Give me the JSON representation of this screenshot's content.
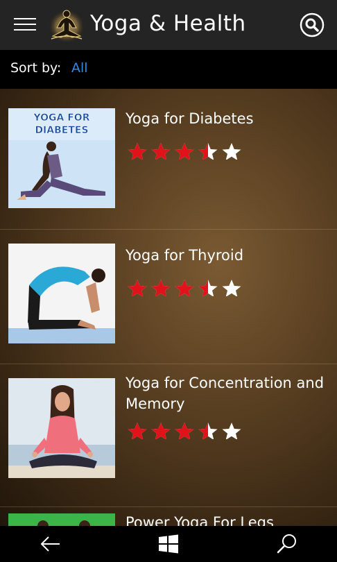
{
  "header": {
    "title": "Yoga & Health",
    "menu_icon": "hamburger-icon",
    "logo_icon": "yoga-lotus-logo-icon",
    "search_icon": "search-icon"
  },
  "sort": {
    "label": "Sort by:",
    "value": "All",
    "value_color": "#2e8be6"
  },
  "items": [
    {
      "title": "Yoga for Diabetes",
      "thumbnail_text": "YOGA FOR DIABETES",
      "rating": 3.5,
      "rating_max": 5
    },
    {
      "title": "Yoga for Thyroid",
      "rating": 3.5,
      "rating_max": 5
    },
    {
      "title": "Yoga for Concentration and Memory",
      "rating": 3.5,
      "rating_max": 5
    },
    {
      "title": "Power Yoga For Legs"
    }
  ],
  "colors": {
    "star_filled": "#e0121a",
    "star_empty": "#ffffff",
    "header_bg": "#242424"
  },
  "bottom_nav": {
    "back_icon": "back-arrow-icon",
    "windows_icon": "windows-logo-icon",
    "search_icon": "search-icon"
  }
}
